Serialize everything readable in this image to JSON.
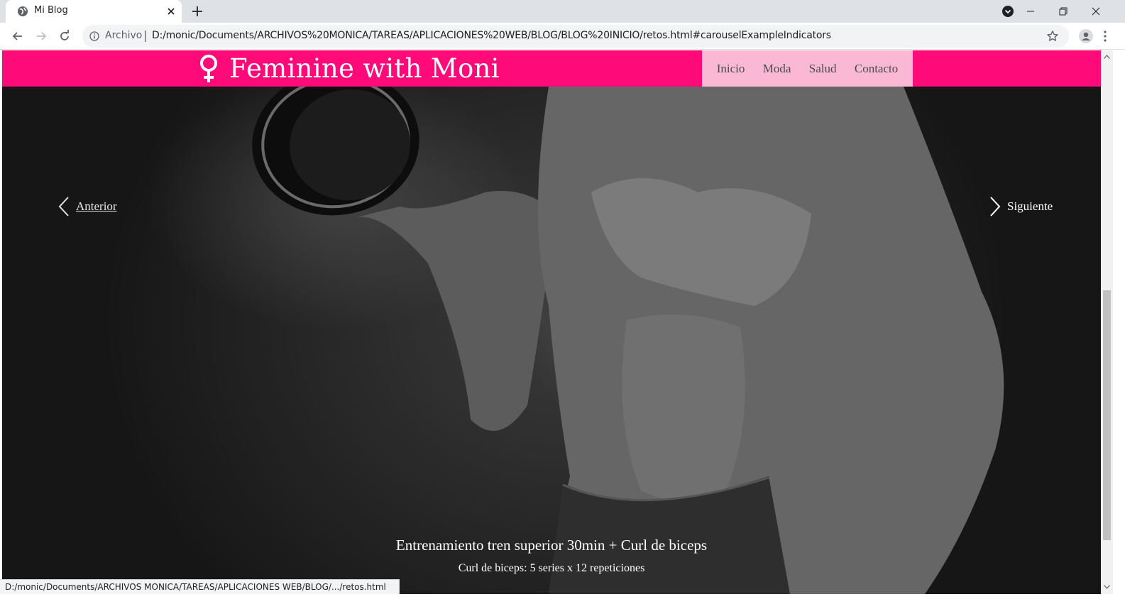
{
  "browser": {
    "tab_title": "Mi Blog",
    "url_origin": "Archivo",
    "url": "D:/monic/Documents/ARCHIVOS%20MONICA/TAREAS/APLICACIONES%20WEB/BLOG/BLOG%20INICIO/retos.html#carouselExampleIndicators",
    "status_url": "D:/monic/Documents/ARCHIVOS MONICA/TAREAS/APLICACIONES WEB/BLOG/.../retos.html"
  },
  "site": {
    "brand": "Feminine with Moni",
    "brand_icon": "venus-icon",
    "nav": [
      {
        "label": "Inicio"
      },
      {
        "label": "Moda"
      },
      {
        "label": "Salud"
      },
      {
        "label": "Contacto"
      }
    ],
    "colors": {
      "navbar": "#ff0a78",
      "nav_links_bg": "#fbb8d4"
    }
  },
  "carousel": {
    "prev_label": "Anterior",
    "next_label": "Siguiente",
    "caption_title": "Entrenamiento tren superior 30min + Curl de biceps",
    "caption_text": "Curl de biceps: 5 series x 12 repeticiones"
  }
}
